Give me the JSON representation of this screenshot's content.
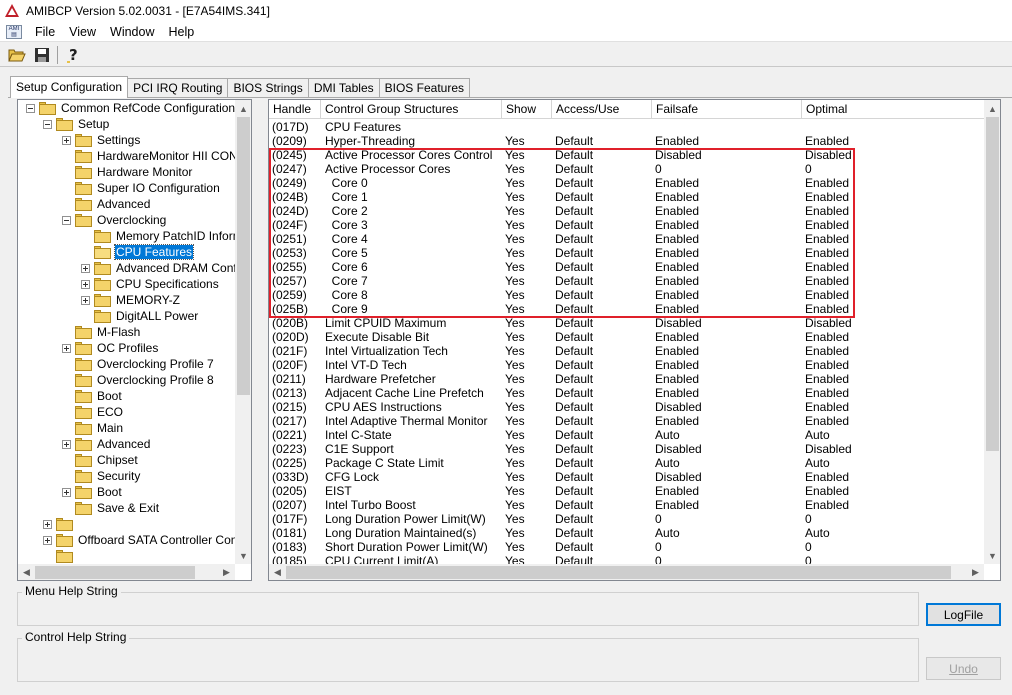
{
  "window": {
    "title": "AMIBCP Version 5.02.0031 - [E7A54IMS.341]"
  },
  "menu": [
    "File",
    "View",
    "Window",
    "Help"
  ],
  "system_menu_icon": "ami-doc-icon",
  "toolbar": {
    "open": "open-folder-icon",
    "save": "save-disk-icon",
    "help": "help-question-icon"
  },
  "tabs": [
    "Setup Configuration",
    "PCI IRQ Routing",
    "BIOS Strings",
    "DMI Tables",
    "BIOS Features"
  ],
  "active_tab": "Setup Configuration",
  "tree": [
    {
      "label": "Common RefCode Configuration",
      "level": 0,
      "exp": "minus"
    },
    {
      "label": "Setup",
      "level": 1,
      "exp": "minus"
    },
    {
      "label": "Settings",
      "level": 2,
      "exp": "plus"
    },
    {
      "label": "HardwareMonitor HII CONFIG",
      "level": 2,
      "exp": "none"
    },
    {
      "label": "Hardware Monitor",
      "level": 2,
      "exp": "none"
    },
    {
      "label": "Super IO Configuration",
      "level": 2,
      "exp": "none"
    },
    {
      "label": "Advanced",
      "level": 2,
      "exp": "none"
    },
    {
      "label": "Overclocking",
      "level": 2,
      "exp": "minus"
    },
    {
      "label": "Memory PatchID Informat",
      "level": 3,
      "exp": "none"
    },
    {
      "label": "CPU Features",
      "level": 3,
      "exp": "none",
      "selected": true
    },
    {
      "label": "Advanced DRAM Configu",
      "level": 3,
      "exp": "plus"
    },
    {
      "label": "CPU Specifications",
      "level": 3,
      "exp": "plus"
    },
    {
      "label": "MEMORY-Z",
      "level": 3,
      "exp": "plus"
    },
    {
      "label": "DigitALL Power",
      "level": 3,
      "exp": "none"
    },
    {
      "label": "M-Flash",
      "level": 2,
      "exp": "none"
    },
    {
      "label": "OC Profiles",
      "level": 2,
      "exp": "plus"
    },
    {
      "label": "Overclocking Profile 7",
      "level": 2,
      "exp": "none"
    },
    {
      "label": "Overclocking Profile 8",
      "level": 2,
      "exp": "none"
    },
    {
      "label": "Boot",
      "level": 2,
      "exp": "none"
    },
    {
      "label": "ECO",
      "level": 2,
      "exp": "none"
    },
    {
      "label": "Main",
      "level": 2,
      "exp": "none"
    },
    {
      "label": "Advanced",
      "level": 2,
      "exp": "plus"
    },
    {
      "label": "Chipset",
      "level": 2,
      "exp": "none"
    },
    {
      "label": "Security",
      "level": 2,
      "exp": "none"
    },
    {
      "label": "Boot",
      "level": 2,
      "exp": "plus"
    },
    {
      "label": "Save & Exit",
      "level": 2,
      "exp": "none"
    },
    {
      "label": "",
      "level": 1,
      "exp": "plus"
    },
    {
      "label": "Offboard SATA Controller Configu",
      "level": 1,
      "exp": "plus"
    },
    {
      "label": "",
      "level": 1,
      "exp": "none"
    }
  ],
  "grid": {
    "columns": [
      "Handle",
      "Control Group Structures",
      "Show",
      "Access/Use",
      "Failsafe",
      "Optimal"
    ],
    "rows": [
      [
        "(017D)",
        "CPU Features",
        "",
        "",
        "",
        ""
      ],
      [
        "(0209)",
        "Hyper-Threading",
        "Yes",
        "Default",
        "Enabled",
        "Enabled"
      ],
      [
        "(0245)",
        "Active Processor Cores Control",
        "Yes",
        "Default",
        "Disabled",
        "Disabled"
      ],
      [
        "(0247)",
        "Active Processor Cores",
        "Yes",
        "Default",
        "0",
        "0"
      ],
      [
        "(0249)",
        "  Core 0",
        "Yes",
        "Default",
        "Enabled",
        "Enabled"
      ],
      [
        "(024B)",
        "  Core 1",
        "Yes",
        "Default",
        "Enabled",
        "Enabled"
      ],
      [
        "(024D)",
        "  Core 2",
        "Yes",
        "Default",
        "Enabled",
        "Enabled"
      ],
      [
        "(024F)",
        "  Core 3",
        "Yes",
        "Default",
        "Enabled",
        "Enabled"
      ],
      [
        "(0251)",
        "  Core 4",
        "Yes",
        "Default",
        "Enabled",
        "Enabled"
      ],
      [
        "(0253)",
        "  Core 5",
        "Yes",
        "Default",
        "Enabled",
        "Enabled"
      ],
      [
        "(0255)",
        "  Core 6",
        "Yes",
        "Default",
        "Enabled",
        "Enabled"
      ],
      [
        "(0257)",
        "  Core 7",
        "Yes",
        "Default",
        "Enabled",
        "Enabled"
      ],
      [
        "(0259)",
        "  Core 8",
        "Yes",
        "Default",
        "Enabled",
        "Enabled"
      ],
      [
        "(025B)",
        "  Core 9",
        "Yes",
        "Default",
        "Enabled",
        "Enabled"
      ],
      [
        "(020B)",
        "Limit CPUID Maximum",
        "Yes",
        "Default",
        "Disabled",
        "Disabled"
      ],
      [
        "(020D)",
        "Execute Disable Bit",
        "Yes",
        "Default",
        "Enabled",
        "Enabled"
      ],
      [
        "(021F)",
        "Intel Virtualization Tech",
        "Yes",
        "Default",
        "Enabled",
        "Enabled"
      ],
      [
        "(020F)",
        "Intel VT-D Tech",
        "Yes",
        "Default",
        "Enabled",
        "Enabled"
      ],
      [
        "(0211)",
        "Hardware Prefetcher",
        "Yes",
        "Default",
        "Enabled",
        "Enabled"
      ],
      [
        "(0213)",
        "Adjacent Cache Line Prefetch",
        "Yes",
        "Default",
        "Enabled",
        "Enabled"
      ],
      [
        "(0215)",
        "CPU AES Instructions",
        "Yes",
        "Default",
        "Disabled",
        "Enabled"
      ],
      [
        "(0217)",
        "Intel Adaptive Thermal Monitor",
        "Yes",
        "Default",
        "Enabled",
        "Enabled"
      ],
      [
        "(0221)",
        "Intel C-State",
        "Yes",
        "Default",
        "Auto",
        "Auto"
      ],
      [
        "(0223)",
        "C1E Support",
        "Yes",
        "Default",
        "Disabled",
        "Disabled"
      ],
      [
        "(0225)",
        "Package C State Limit",
        "Yes",
        "Default",
        "Auto",
        "Auto"
      ],
      [
        "(033D)",
        "CFG Lock",
        "Yes",
        "Default",
        "Disabled",
        "Enabled"
      ],
      [
        "(0205)",
        "EIST",
        "Yes",
        "Default",
        "Enabled",
        "Enabled"
      ],
      [
        "(0207)",
        "Intel Turbo Boost",
        "Yes",
        "Default",
        "Enabled",
        "Enabled"
      ],
      [
        "(017F)",
        "Long Duration Power Limit(W)",
        "Yes",
        "Default",
        "0",
        "0"
      ],
      [
        "(0181)",
        "Long Duration Maintained(s)",
        "Yes",
        "Default",
        "Auto",
        "Auto"
      ],
      [
        "(0183)",
        "Short Duration Power Limit(W)",
        "Yes",
        "Default",
        "0",
        "0"
      ],
      [
        "(0185)",
        "CPU Current Limit(A)",
        "Yes",
        "Default",
        "0",
        "0"
      ]
    ]
  },
  "highlight_color": "#e0202a",
  "selection_color": "#0078d7",
  "bottom": {
    "menu_help_label": "Menu Help String",
    "control_help_label": "Control Help String",
    "logfile_button": "LogFile",
    "undo_button": "Undo"
  }
}
